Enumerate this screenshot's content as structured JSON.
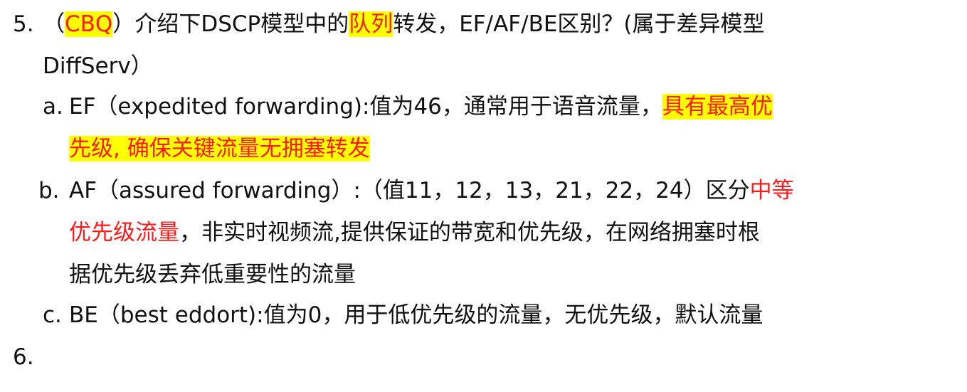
{
  "item5": {
    "number": "5.",
    "open_paren": "（",
    "cbq": "CBQ",
    "mid": "）介绍下DSCP模型中的",
    "queue": "队列",
    "tail": "转发，EF/AF/BE区别？(属于差异模型",
    "line2": "DiffServ）"
  },
  "sub_a": {
    "marker": "a.",
    "text": "EF（expedited forwarding):值为46，通常用于语音流量，",
    "highlight1": "具有最高优",
    "highlight2": "先级, 确保关键流量无拥塞转发"
  },
  "sub_b": {
    "marker": "b.",
    "text": "AF（assured forwarding）:（值11，12，13，21，22，24）区分",
    "red1": "中等",
    "red2": "优先级流量",
    "line2_rest": "，非实时视频流,提供保证的带宽和优先级，在网络拥塞时根",
    "line3": "据优先级丢弃低重要性的流量"
  },
  "sub_c": {
    "marker": "c.",
    "text": "BE（best eddort):值为0，用于低优先级的流量，无优先级，默认流量"
  },
  "item6": {
    "number": "6."
  },
  "colors": {
    "highlight": "#ffff00",
    "red_text": "#ff1a1a",
    "body_text": "#111111"
  }
}
